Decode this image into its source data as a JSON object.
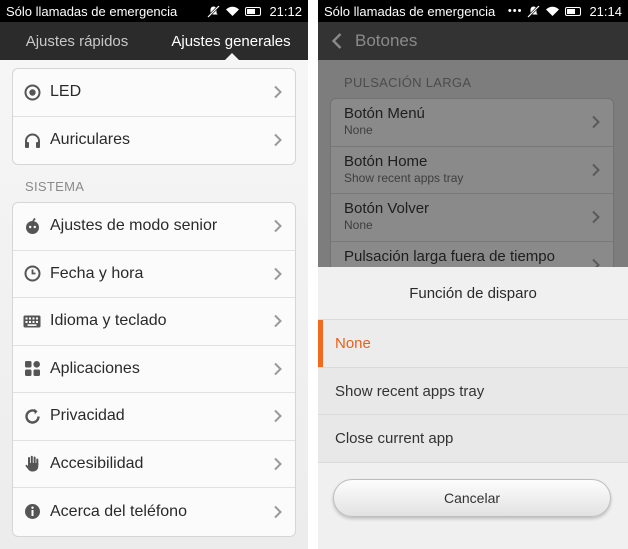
{
  "left": {
    "status": {
      "carrier": "Sólo llamadas de emergencia",
      "time": "21:12"
    },
    "tabs": [
      {
        "label": "Ajustes rápidos"
      },
      {
        "label": "Ajustes generales"
      }
    ],
    "top_items": [
      {
        "label": "LED",
        "icon": "led-icon"
      },
      {
        "label": "Auriculares",
        "icon": "headphones-icon"
      }
    ],
    "section": "SISTEMA",
    "system_items": [
      {
        "label": "Ajustes de modo senior",
        "icon": "senior-mode-icon"
      },
      {
        "label": "Fecha y hora",
        "icon": "clock-icon"
      },
      {
        "label": "Idioma y teclado",
        "icon": "keyboard-icon"
      },
      {
        "label": "Aplicaciones",
        "icon": "apps-icon"
      },
      {
        "label": "Privacidad",
        "icon": "privacy-icon"
      },
      {
        "label": "Accesibilidad",
        "icon": "hand-icon"
      },
      {
        "label": "Acerca del teléfono",
        "icon": "info-icon"
      }
    ]
  },
  "right": {
    "status": {
      "carrier": "Sólo llamadas de emergencia",
      "dots": "•••",
      "time": "21:14"
    },
    "title": "Botones",
    "section": "PULSACIÓN LARGA",
    "items": [
      {
        "title": "Botón Menú",
        "value": "None"
      },
      {
        "title": "Botón Home",
        "value": "Show recent apps tray"
      },
      {
        "title": "Botón Volver",
        "value": "None"
      },
      {
        "title": "Pulsación larga fuera de tiempo",
        "value": ""
      }
    ],
    "dialog": {
      "title": "Función de disparo",
      "options": [
        "None",
        "Show recent apps tray",
        "Close current app"
      ],
      "selected": "None",
      "cancel_label": "Cancelar",
      "accent_color": "#f06a22"
    }
  }
}
